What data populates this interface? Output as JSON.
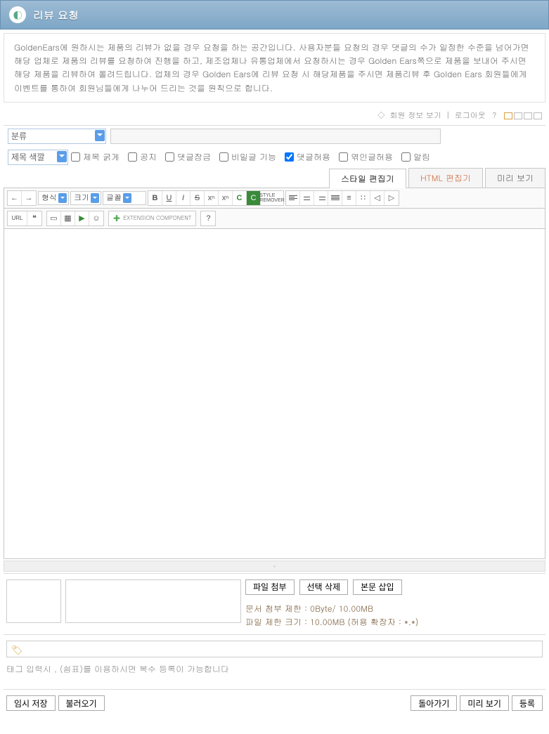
{
  "header": {
    "title": "리뷰 요청"
  },
  "intro": {
    "body": "GoldenEars에 원하시는 제품의 리뷰가 없을 경우 요청을 하는 공간입니다. 사용자분들 요청의 경우 댓글의 수가 일정한 수준을 넘어가면 해당 업체로 제품의 리뷰를 요청하여 진행을 하고, 제조업체나 유통업체에서 요청하시는 경우 Golden Ears쪽으로 제품을 보내어 주시면 해당 제품을 리뷰하여 올려드립니다. 업체의 경우 Golden Ears에 리뷰 요청 시 해당제품을 주시면 제품리뷰 후 Golden Ears 회원들에게 이벤트를 통하여 회원님들에게 나누어 드리는 것을 원칙으로 합니다."
  },
  "toplinks": {
    "member_info": "회원 정보 보기",
    "logout": "로그아웃"
  },
  "form": {
    "category_label": "분류",
    "color_label": "제목 색깔",
    "options": {
      "bold": "제목 굵게",
      "notice": "공지",
      "lock_comment": "댓글잠금",
      "secret": "비밀글 기능",
      "allow_comment": "댓글허용",
      "allow_trackback": "엮인글허용",
      "notify": "알림"
    }
  },
  "tabs": {
    "style": "스타일 편집기",
    "html": "HTML 편집기",
    "preview": "미리 보기"
  },
  "toolbar": {
    "format": "형식",
    "size": "크기",
    "font": "글꼴",
    "url": "URL",
    "extension": "EXTENSION COMPONENT"
  },
  "editor": {
    "content": ""
  },
  "attach": {
    "btn_file": "파일 첨부",
    "btn_delete": "선택 삭제",
    "btn_insert": "본문 삽입",
    "limit_doc": "문서 첨부 제한 : 0Byte/ 10.00MB",
    "limit_file": "파일 제한 크기 : 10.00MB (허용 확장자 : *.*)"
  },
  "tag": {
    "hint": "태그 입력시 , (쉼표)를 이용하시면 복수 등록이 가능합니다"
  },
  "footer": {
    "temp_save": "임시 저장",
    "load": "불러오기",
    "back": "돌아가기",
    "preview": "미리 보기",
    "submit": "등록"
  }
}
